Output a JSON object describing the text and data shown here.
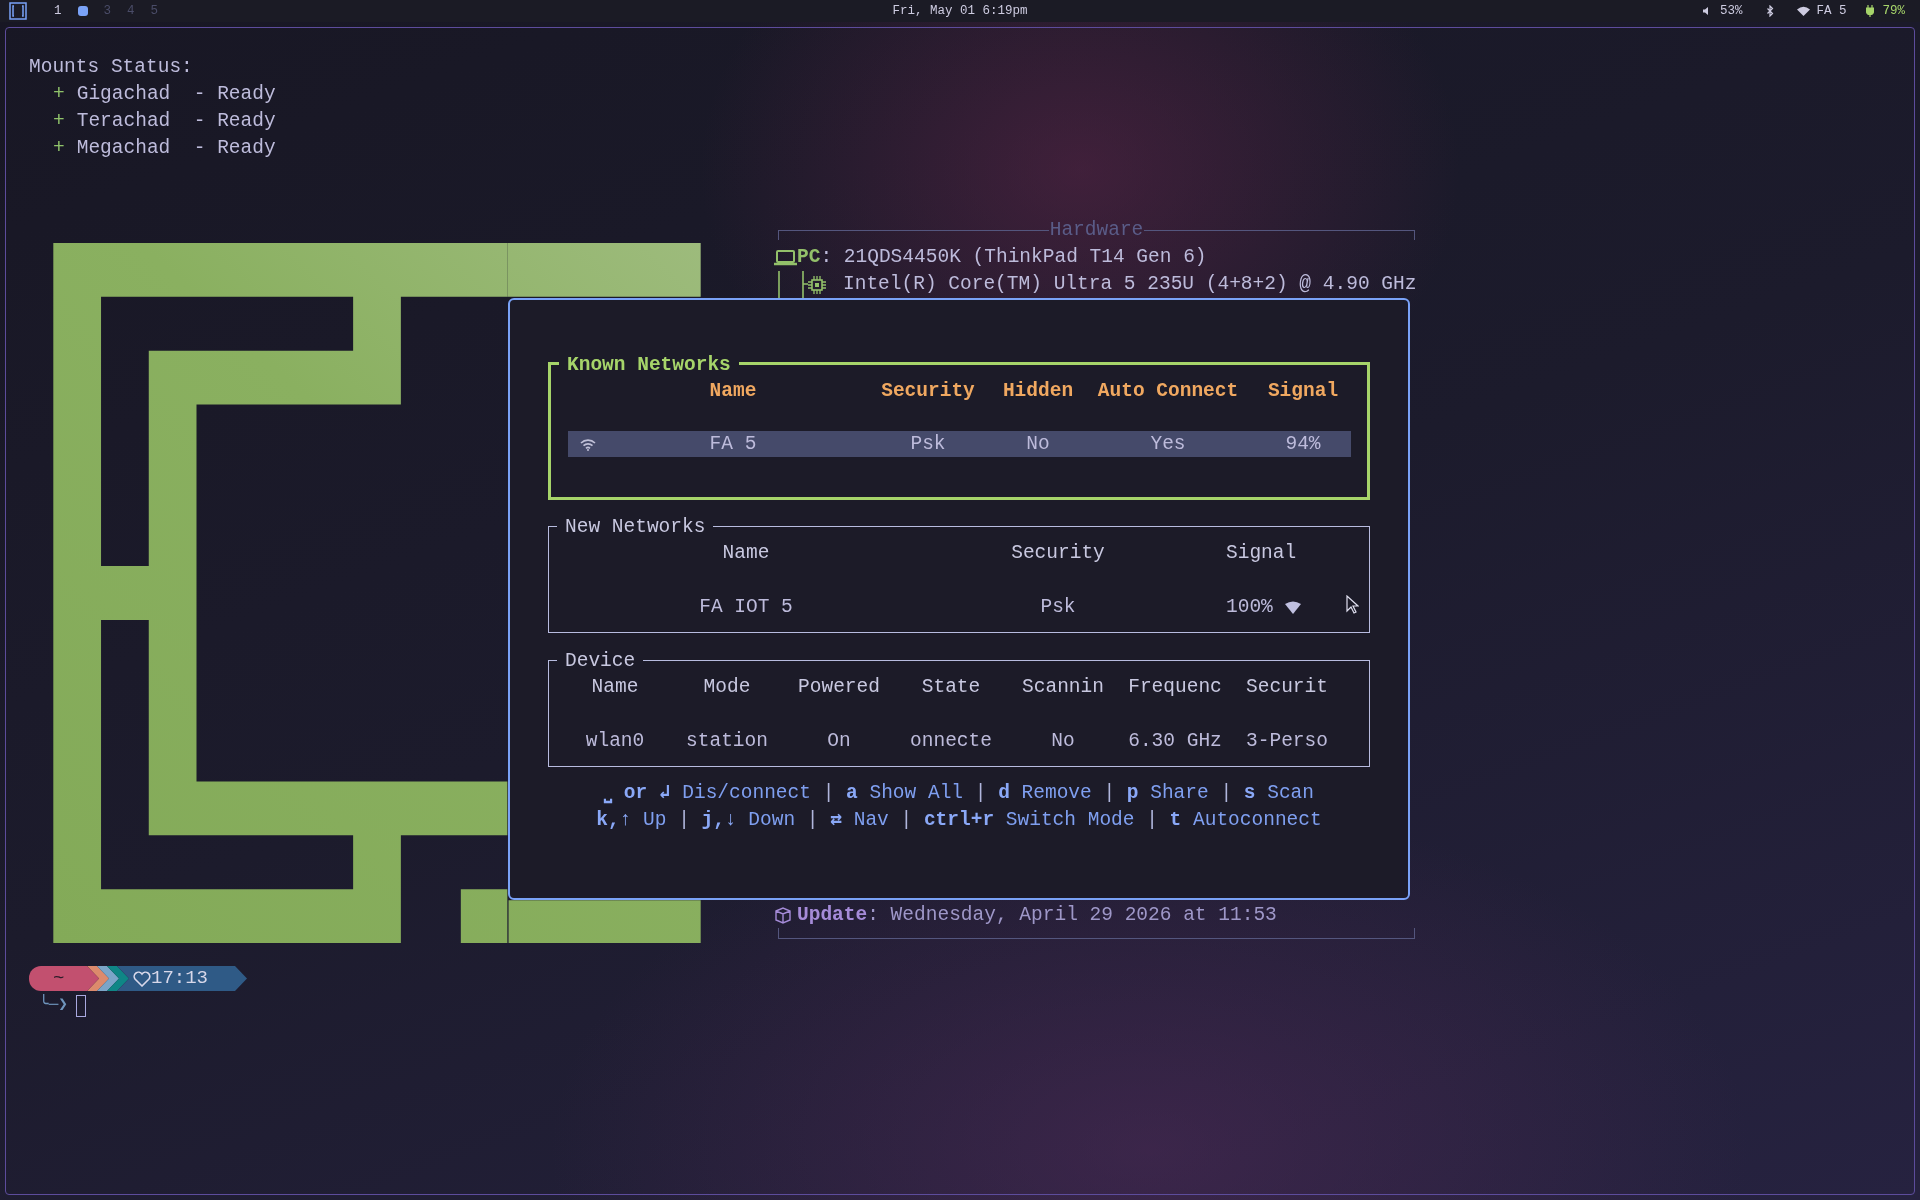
{
  "top_bar": {
    "workspaces": [
      {
        "label": "1",
        "selected": false,
        "occupied": true
      },
      {
        "selected": true,
        "occupied": true
      },
      {
        "label": "3",
        "selected": false,
        "occupied": false
      },
      {
        "label": "4",
        "selected": false,
        "occupied": false
      },
      {
        "label": "5",
        "selected": false,
        "occupied": false
      }
    ],
    "clock": "Fri, May 01 6:19pm",
    "volume": "53%",
    "network": "FA 5",
    "battery": "79%"
  },
  "terminal": {
    "mounts": {
      "title": "Mounts Status:",
      "items": [
        {
          "marker": "+",
          "text": "Gigachad  - Ready"
        },
        {
          "marker": "+",
          "text": "Terachad  - Ready"
        },
        {
          "marker": "+",
          "text": "Megachad  - Ready"
        }
      ]
    },
    "hardware": {
      "title": "Hardware",
      "pc_label": "PC",
      "pc_value": ": 21QDS4450K (ThinkPad T14 Gen 6)",
      "cpu": "Intel(R) Core(TM) Ultra 5 235U (4+8+2) @ 4.90 GHz",
      "update_label": "Update",
      "update_value": ": Wednesday, April 29 2026 at 11:53"
    },
    "prompt": {
      "directory": "~",
      "time": "17:13",
      "symbol": "╰─❯"
    }
  },
  "popup": {
    "known_networks": {
      "title": "Known Networks",
      "focused": true,
      "columns": [
        "Name",
        "Security",
        "Hidden",
        "Auto Connect",
        "Signal"
      ],
      "rows": [
        {
          "name": "FA 5",
          "security": "Psk",
          "hidden": "No",
          "auto_connect": "Yes",
          "signal": "94%",
          "connected": true,
          "selected": true
        }
      ]
    },
    "new_networks": {
      "title": "New Networks",
      "focused": false,
      "columns": [
        "Name",
        "Security",
        "Signal"
      ],
      "rows": [
        {
          "name": "FA IOT 5",
          "security": "Psk",
          "signal": "100%"
        }
      ]
    },
    "device": {
      "title": "Device",
      "focused": false,
      "columns": [
        "Name",
        "Mode",
        "Powered",
        "State",
        "Scannin",
        "Frequenc",
        "Securit"
      ],
      "rows": [
        [
          "wlan0",
          "station",
          "On",
          "onnecte",
          "No",
          "6.30 GHz",
          "3-Perso"
        ]
      ]
    },
    "help": [
      [
        {
          "key": "⎵ or ↲",
          "action": "Dis/connect",
          "separator": "|"
        },
        {
          "key": "a",
          "action": "Show All",
          "separator": "|"
        },
        {
          "key": "d",
          "action": "Remove",
          "separator": "|"
        },
        {
          "key": "p",
          "action": "Share",
          "separator": "|"
        },
        {
          "key": "s",
          "action": "Scan"
        }
      ],
      [
        {
          "key": "k,↑",
          "action": "Up",
          "separator": "|"
        },
        {
          "key": "j,↓",
          "action": "Down",
          "separator": "|"
        },
        {
          "key": "⇄",
          "action": "Nav",
          "separator": "|"
        },
        {
          "key": "ctrl+r",
          "action": "Switch Mode",
          "separator": "|"
        },
        {
          "key": "t",
          "action": "Autoconnect"
        }
      ]
    ]
  }
}
